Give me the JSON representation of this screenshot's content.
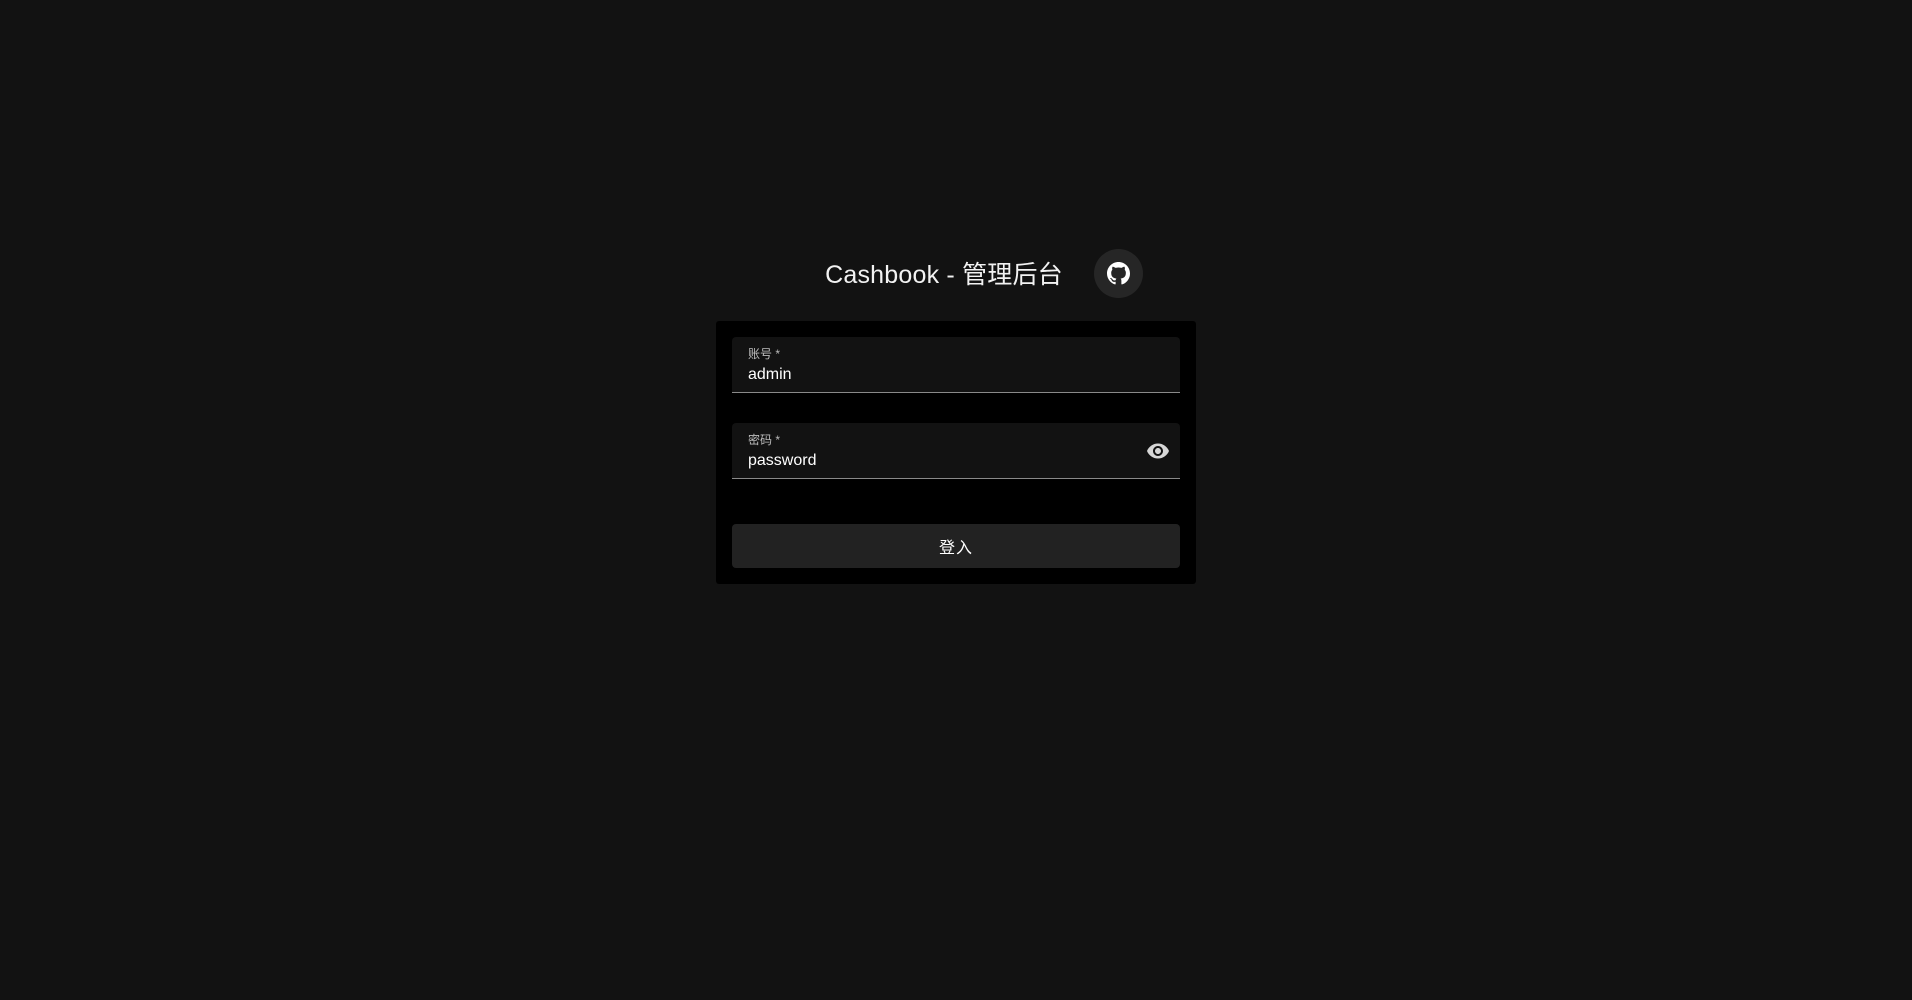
{
  "header": {
    "title": "Cashbook - 管理后台",
    "github_icon": "github-icon"
  },
  "form": {
    "account": {
      "label": "账号 *",
      "value": "admin"
    },
    "password": {
      "label": "密码 *",
      "value": "password",
      "toggle_icon": "eye-icon"
    },
    "login_label": "登入"
  },
  "colors": {
    "background": "#121212",
    "card": "#000000",
    "field": "#121212",
    "button": "#222222",
    "icon_button": "#262626"
  }
}
